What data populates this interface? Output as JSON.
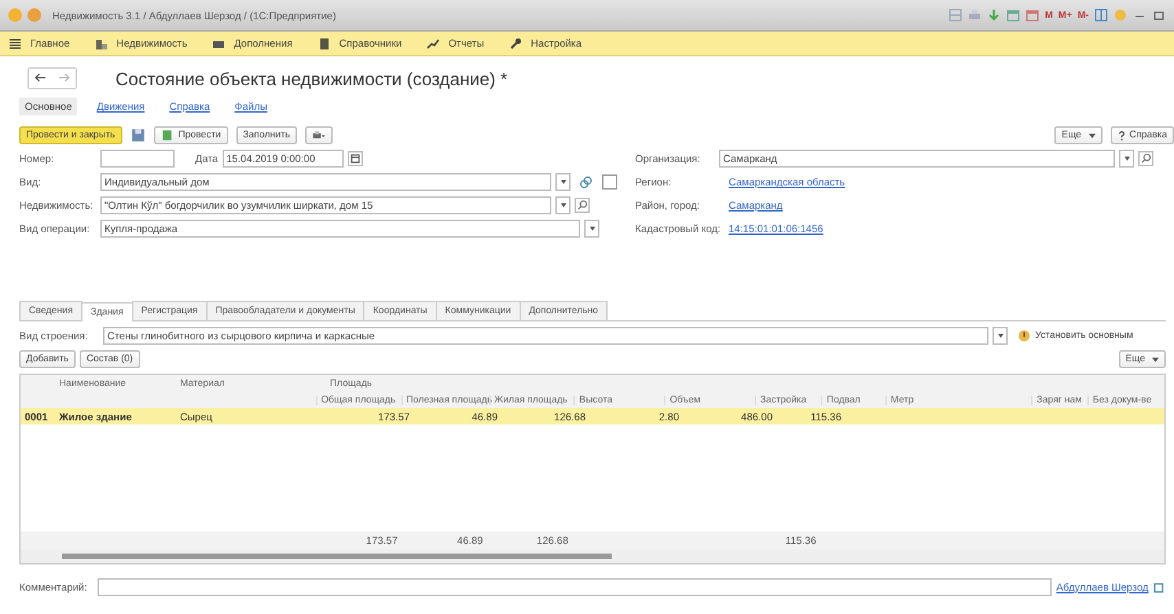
{
  "window": {
    "title": "Недвижимость 3.1 / Абдуллаев Шерзод / (1С:Предприятие)",
    "tools": [
      "M",
      "M+",
      "M-"
    ]
  },
  "menu": [
    {
      "label": "Главное"
    },
    {
      "label": "Недвижимость"
    },
    {
      "label": "Дополнения"
    },
    {
      "label": "Справочники"
    },
    {
      "label": "Отчеты"
    },
    {
      "label": "Настройка"
    }
  ],
  "document": {
    "title": "Состояние объекта недвижимости (создание) *"
  },
  "sections": [
    {
      "label": "Основное",
      "selected": true
    },
    {
      "label": "Движения",
      "selected": false
    },
    {
      "label": "Справка",
      "selected": false
    },
    {
      "label": "Файлы",
      "selected": false
    }
  ],
  "toolbar": {
    "post_close": "Провести и закрыть",
    "post": "Провести",
    "fill": "Заполнить",
    "more": "Еще",
    "help": "Справка"
  },
  "form": {
    "number_label": "Номер:",
    "date_label": "Дата",
    "date": "15.04.2019 0:00:00",
    "kind_label": "Вид:",
    "kind": "Индивидуальный дом",
    "kind_checked": false,
    "property_label": "Недвижимость:",
    "property": "\"Олтин Кўл\" богдорчилик во узумчилик ширкати, дом 15",
    "operation_label": "Вид операции:",
    "operation": "Купля-продажа",
    "org_label": "Организация:",
    "org": "Самарканд",
    "region_label": "Регион:",
    "region": "Самаркандская область",
    "city_label": "Район, город:",
    "city": "Самарканд",
    "cadastre_label": "Кадастровый код:",
    "cadastre": "14:15:01:01:06:1456"
  },
  "tabs": [
    {
      "label": "Сведения",
      "selected": false
    },
    {
      "label": "Здания",
      "selected": true
    },
    {
      "label": "Регистрация",
      "selected": false
    },
    {
      "label": "Правообладатели и документы",
      "selected": false
    },
    {
      "label": "Координаты",
      "selected": false
    },
    {
      "label": "Коммуникации",
      "selected": false
    },
    {
      "label": "Дополнительно",
      "selected": false
    }
  ],
  "building": {
    "label": "Вид строения:",
    "value": "Стены глинобитного из сырцового кирпича и каркасные",
    "set_main": "Установить основным",
    "add": "Добавить",
    "composition": "Состав (0)",
    "more": "Еще"
  },
  "table": {
    "columns": [
      "Наименование",
      "Материал"
    ],
    "group": "Площадь",
    "subcolumns": [
      "Общая площадь",
      "Полезная площадь",
      "Жилая площадь",
      "Высота",
      "Объем",
      "Застройка",
      "Подвал",
      "Метр",
      "Заряг нам",
      "Без докум-ве"
    ],
    "rows": [
      {
        "code": "0001",
        "cells": [
          "Жилое здание",
          "Сырец",
          "173.57",
          "46.89",
          "126.68",
          "2.80",
          "486.00",
          "115.36"
        ],
        "selected": true
      }
    ],
    "totals": [
      "173.57",
      "46.89",
      "126.68",
      "115.36"
    ]
  },
  "footer": {
    "comment_label": "Комментарий:",
    "user": "Абдуллаев Шерзод"
  }
}
